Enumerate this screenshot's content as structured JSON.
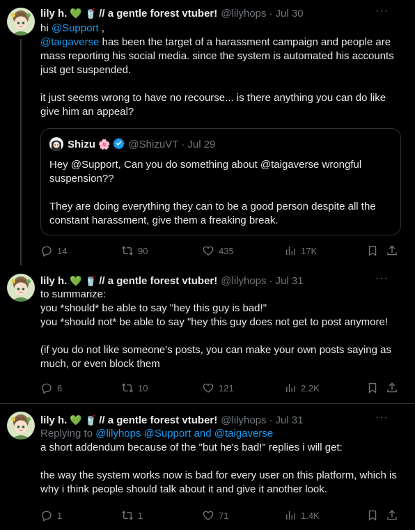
{
  "tweets": [
    {
      "display_name": "lily h.",
      "emoji_heart": "💚",
      "emoji_drink": "🥤",
      "name_suffix": "// a gentle forest vtuber!",
      "handle": "@lilyhops",
      "dot": "·",
      "date": "Jul 30",
      "more": "···",
      "greeting_prefix": "hi ",
      "mention_support": "@Support",
      "greeting_suffix": " ,",
      "mention_taiga": "@taigaverse",
      "body_rest": " has been the target of a harassment campaign and people are mass reporting his social media. since the system is automated his accounts just get suspended.\n\nit just seems wrong to have no recourse... is there anything you can do like give him an appeal?",
      "quote": {
        "display_name": "Shizu",
        "emoji": "🌸",
        "handle": "@ShizuVT",
        "dot": "·",
        "date": "Jul 29",
        "body": "Hey @Support, Can you do something about @taigaverse wrongful suspension??\n\nThey are doing everything they can to be a good person despite all the constant harassment, give them a freaking break."
      },
      "stats": {
        "replies": "14",
        "retweets": "90",
        "likes": "435",
        "views": "17K"
      }
    },
    {
      "display_name": "lily h.",
      "emoji_heart": "💚",
      "emoji_drink": "🥤",
      "name_suffix": "// a gentle forest vtuber!",
      "handle": "@lilyhops",
      "dot": "·",
      "date": "Jul 31",
      "more": "···",
      "body": "to summarize:\nyou *should* be able to say \"hey this guy is bad!\"\nyou *should not* be able to say \"hey this guy does not get to post anymore!\n\n(if you do not like someone's posts, you can make your own posts saying as much, or even block them",
      "stats": {
        "replies": "6",
        "retweets": "10",
        "likes": "121",
        "views": "2.2K"
      }
    },
    {
      "display_name": "lily h.",
      "emoji_heart": "💚",
      "emoji_drink": "🥤",
      "name_suffix": "// a gentle forest vtuber!",
      "handle": "@lilyhops",
      "dot": "·",
      "date": "Jul 31",
      "more": "···",
      "replying_label": "Replying to ",
      "replying_mentions": "@lilyhops @Support and @taigaverse",
      "body": "a short addendum because of the \"but he's bad!\" replies i will get:\n\nthe way the system works now is bad for every user on this platform, which is why i think people should talk about it and give it another look.",
      "stats": {
        "replies": "1",
        "retweets": "1",
        "likes": "71",
        "views": "1.4K"
      }
    }
  ],
  "colors": {
    "accent": "#1d9bf0",
    "muted": "#71767b",
    "text": "#e7e9ea",
    "background": "#000000",
    "border": "#2f3336",
    "verified": "#1d9bf0"
  },
  "icons": [
    "reply-icon",
    "retweet-icon",
    "like-icon",
    "views-icon",
    "bookmark-icon",
    "share-icon",
    "verified-icon",
    "more-icon"
  ]
}
